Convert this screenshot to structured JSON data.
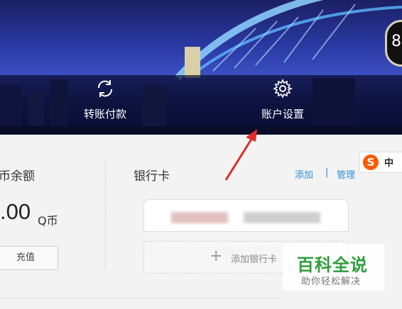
{
  "nav": {
    "items": [
      {
        "label": "转账付款",
        "icon": "refresh-icon"
      },
      {
        "label": "账户设置",
        "icon": "gear-icon"
      }
    ],
    "avatar_text": "8"
  },
  "balance": {
    "title": "币余额",
    "amount": ".00",
    "unit": "Q币",
    "recharge_label": "充值"
  },
  "bank": {
    "title": "银行卡",
    "add_link": "添加",
    "separator": "|",
    "manage_link": "管理",
    "add_card_label": "添加银行卡"
  },
  "ime": {
    "logo": "S",
    "mode": "中"
  },
  "watermark": {
    "title": "百科全说",
    "subtitle": "助你轻松解决"
  },
  "colors": {
    "link": "#2b8fd6",
    "arrow": "#e02a2a",
    "watermark_green": "#2e9e3a"
  }
}
